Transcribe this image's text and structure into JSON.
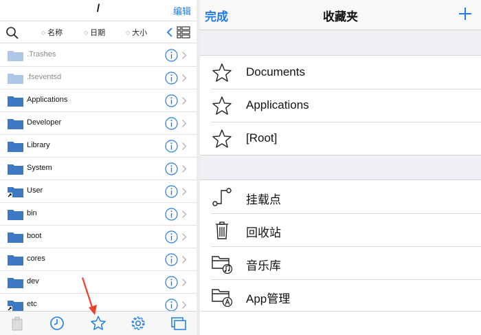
{
  "left": {
    "path": "/",
    "edit_label": "编辑",
    "sort": {
      "name": "名称",
      "date": "日期",
      "size": "大小"
    },
    "files": [
      {
        "name": ".Trashes",
        "dim": true,
        "alias": false
      },
      {
        "name": ".fseventsd",
        "dim": true,
        "alias": false
      },
      {
        "name": "Applications",
        "dim": false,
        "alias": false
      },
      {
        "name": "Developer",
        "dim": false,
        "alias": false
      },
      {
        "name": "Library",
        "dim": false,
        "alias": false
      },
      {
        "name": "System",
        "dim": false,
        "alias": false
      },
      {
        "name": "User",
        "dim": false,
        "alias": true
      },
      {
        "name": "bin",
        "dim": false,
        "alias": false
      },
      {
        "name": "boot",
        "dim": false,
        "alias": false
      },
      {
        "name": "cores",
        "dim": false,
        "alias": false
      },
      {
        "name": "dev",
        "dim": false,
        "alias": false
      },
      {
        "name": "etc",
        "dim": false,
        "alias": true
      }
    ],
    "tabs": [
      "box-icon",
      "clock-icon",
      "star-icon",
      "gear-icon",
      "windows-icon"
    ]
  },
  "right": {
    "done_label": "完成",
    "title": "收藏夹",
    "favorites": [
      "Documents",
      "Applications",
      "[Root]"
    ],
    "tools": [
      {
        "label": "挂载点",
        "icon": "mount-point-icon"
      },
      {
        "label": "回收站",
        "icon": "trash-icon"
      },
      {
        "label": "音乐库",
        "icon": "music-folder-icon"
      },
      {
        "label": "App管理",
        "icon": "app-folder-icon"
      }
    ]
  },
  "colors": {
    "accent": "#1e7be8",
    "folder": "#3d78c2",
    "folder_dim": "#aec6e6",
    "annotation_arrow": "#e8412c"
  }
}
